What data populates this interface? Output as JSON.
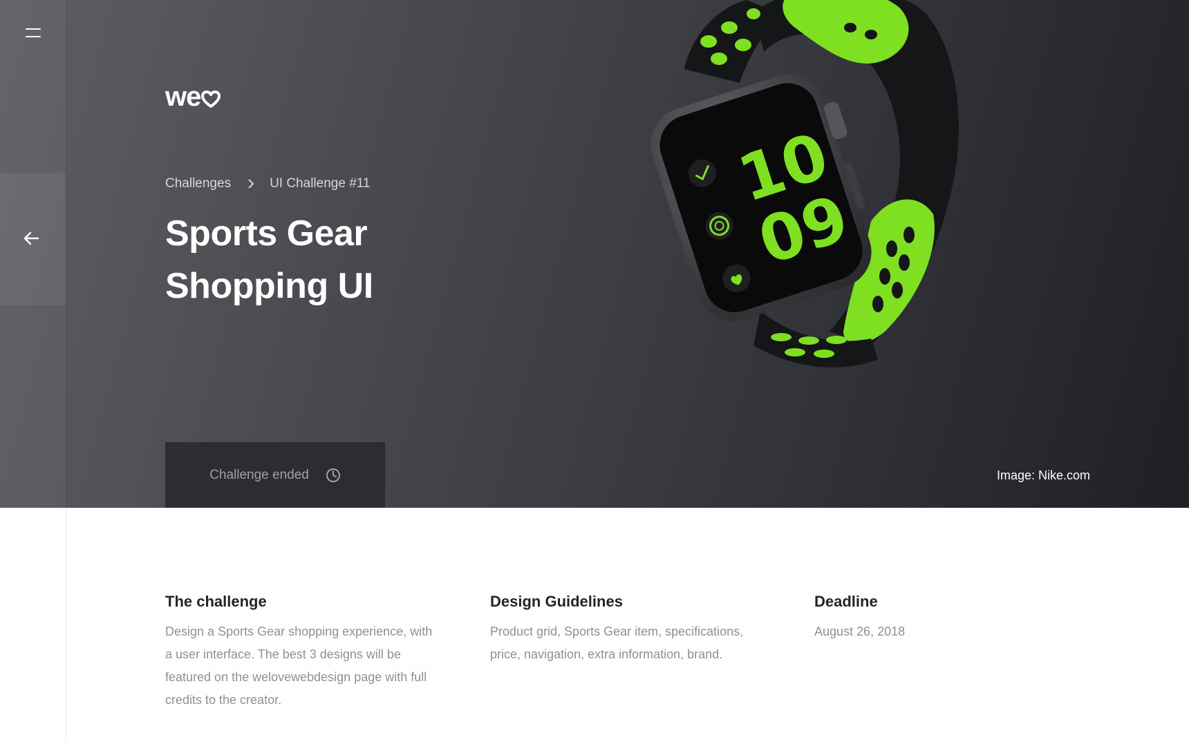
{
  "nav": {
    "menu_icon": "hamburger-menu-icon",
    "back_icon": "arrow-left-icon"
  },
  "brand": {
    "logo_text": "we",
    "logo_icon": "heart-icon"
  },
  "breadcrumb": {
    "items": [
      "Challenges",
      "UI Challenge #11"
    ],
    "separator_icon": "chevron-right-icon"
  },
  "hero": {
    "title_line1": "Sports Gear",
    "title_line2": "Shopping UI",
    "status_label": "Challenge ended",
    "status_icon": "clock-icon",
    "image_credit": "Image: Nike.com",
    "watch_time_hours": "10",
    "watch_time_minutes": "09"
  },
  "info": {
    "challenge": {
      "heading": "The challenge",
      "text": "Design a Sports Gear shopping experience, with a user interface. The best 3 designs will be featured on the welovewebdesign page with full credits to the creator."
    },
    "guidelines": {
      "heading": "Design Guidelines",
      "text": "Product grid, Sports Gear item, specifications, price, navigation, extra information, brand."
    },
    "deadline": {
      "heading": "Deadline",
      "text": "August 26, 2018"
    }
  },
  "colors": {
    "accent_green": "#7ee021",
    "hero_dark": "#2b2d31",
    "text_dark": "#23252a",
    "text_muted": "#8e9096"
  }
}
